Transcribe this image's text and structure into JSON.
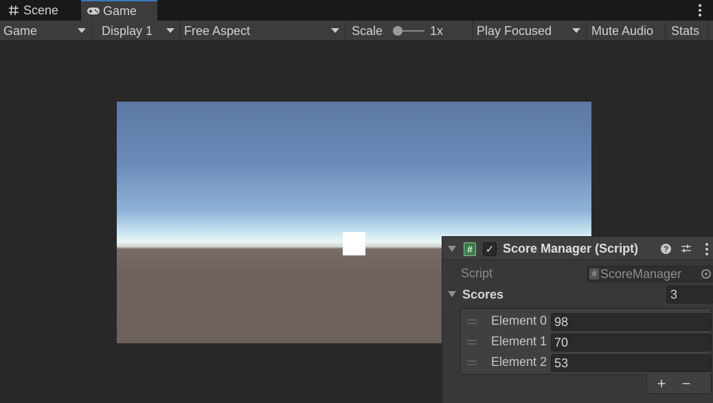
{
  "tabs": [
    {
      "label": "Scene",
      "icon": "grid-hash-icon"
    },
    {
      "label": "Game",
      "icon": "gamepad-icon",
      "active": true
    }
  ],
  "toolbar": {
    "view_mode": "Game",
    "display": "Display 1",
    "aspect": "Free Aspect",
    "scale_label": "Scale",
    "scale_value": "1x",
    "play_mode": "Play Focused",
    "mute_audio": "Mute Audio",
    "stats": "Stats"
  },
  "component": {
    "title": "Score Manager (Script)",
    "enabled": true,
    "script_label": "Script",
    "script_value": "ScoreManager",
    "scores_label": "Scores",
    "scores_count": "3",
    "elements": [
      {
        "label": "Element 0",
        "value": "98"
      },
      {
        "label": "Element 1",
        "value": "70"
      },
      {
        "label": "Element 2",
        "value": "53"
      }
    ],
    "add_label": "+",
    "remove_label": "−"
  },
  "colors": {
    "accent_tab": "#3a79bb",
    "panel_bg": "#383838",
    "window_bg": "#282828"
  }
}
